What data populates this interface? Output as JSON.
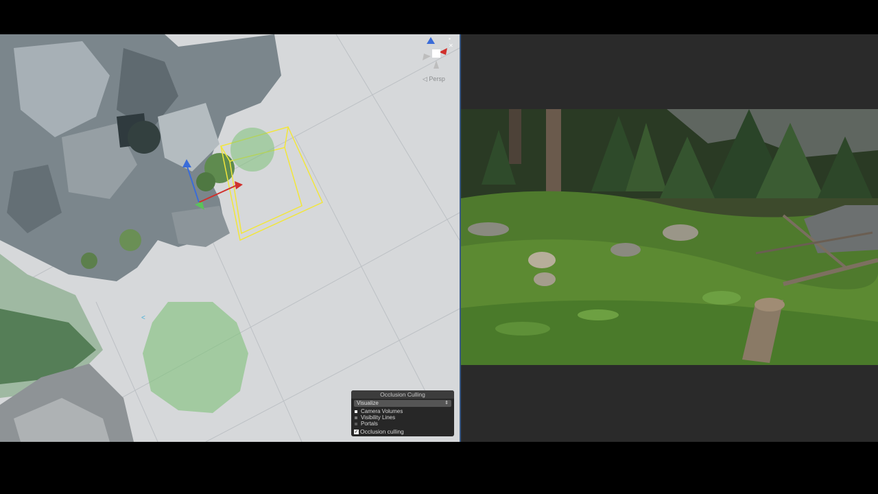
{
  "scene_view": {
    "persp_label": "◁ Persp",
    "gizmo": {
      "name": "axis-orientation-gizmo",
      "x_color": "#d0302c",
      "y_color": "#3a6cd8",
      "z_color": "#3a6cd8"
    },
    "selection_color": "#f2e63a",
    "volume_color": "#7fc27a"
  },
  "occlusion_panel": {
    "title": "Occlusion Culling",
    "mode_select": "Visualize",
    "legend": [
      {
        "label": "Camera Volumes",
        "color": "#ffffff"
      },
      {
        "label": "Visibility Lines",
        "color": "#7a7a7a"
      },
      {
        "label": "Portals",
        "color": "#5a5a5a"
      }
    ],
    "toggle_label": "Occlusion culling",
    "toggle_checked": true
  },
  "game_view": {
    "description_icons": "forest-scene"
  },
  "colors": {
    "background": "#000000",
    "scene_bg": "#d6d8da",
    "game_bg": "#2a2a2a",
    "divider": "#3a5a86"
  }
}
